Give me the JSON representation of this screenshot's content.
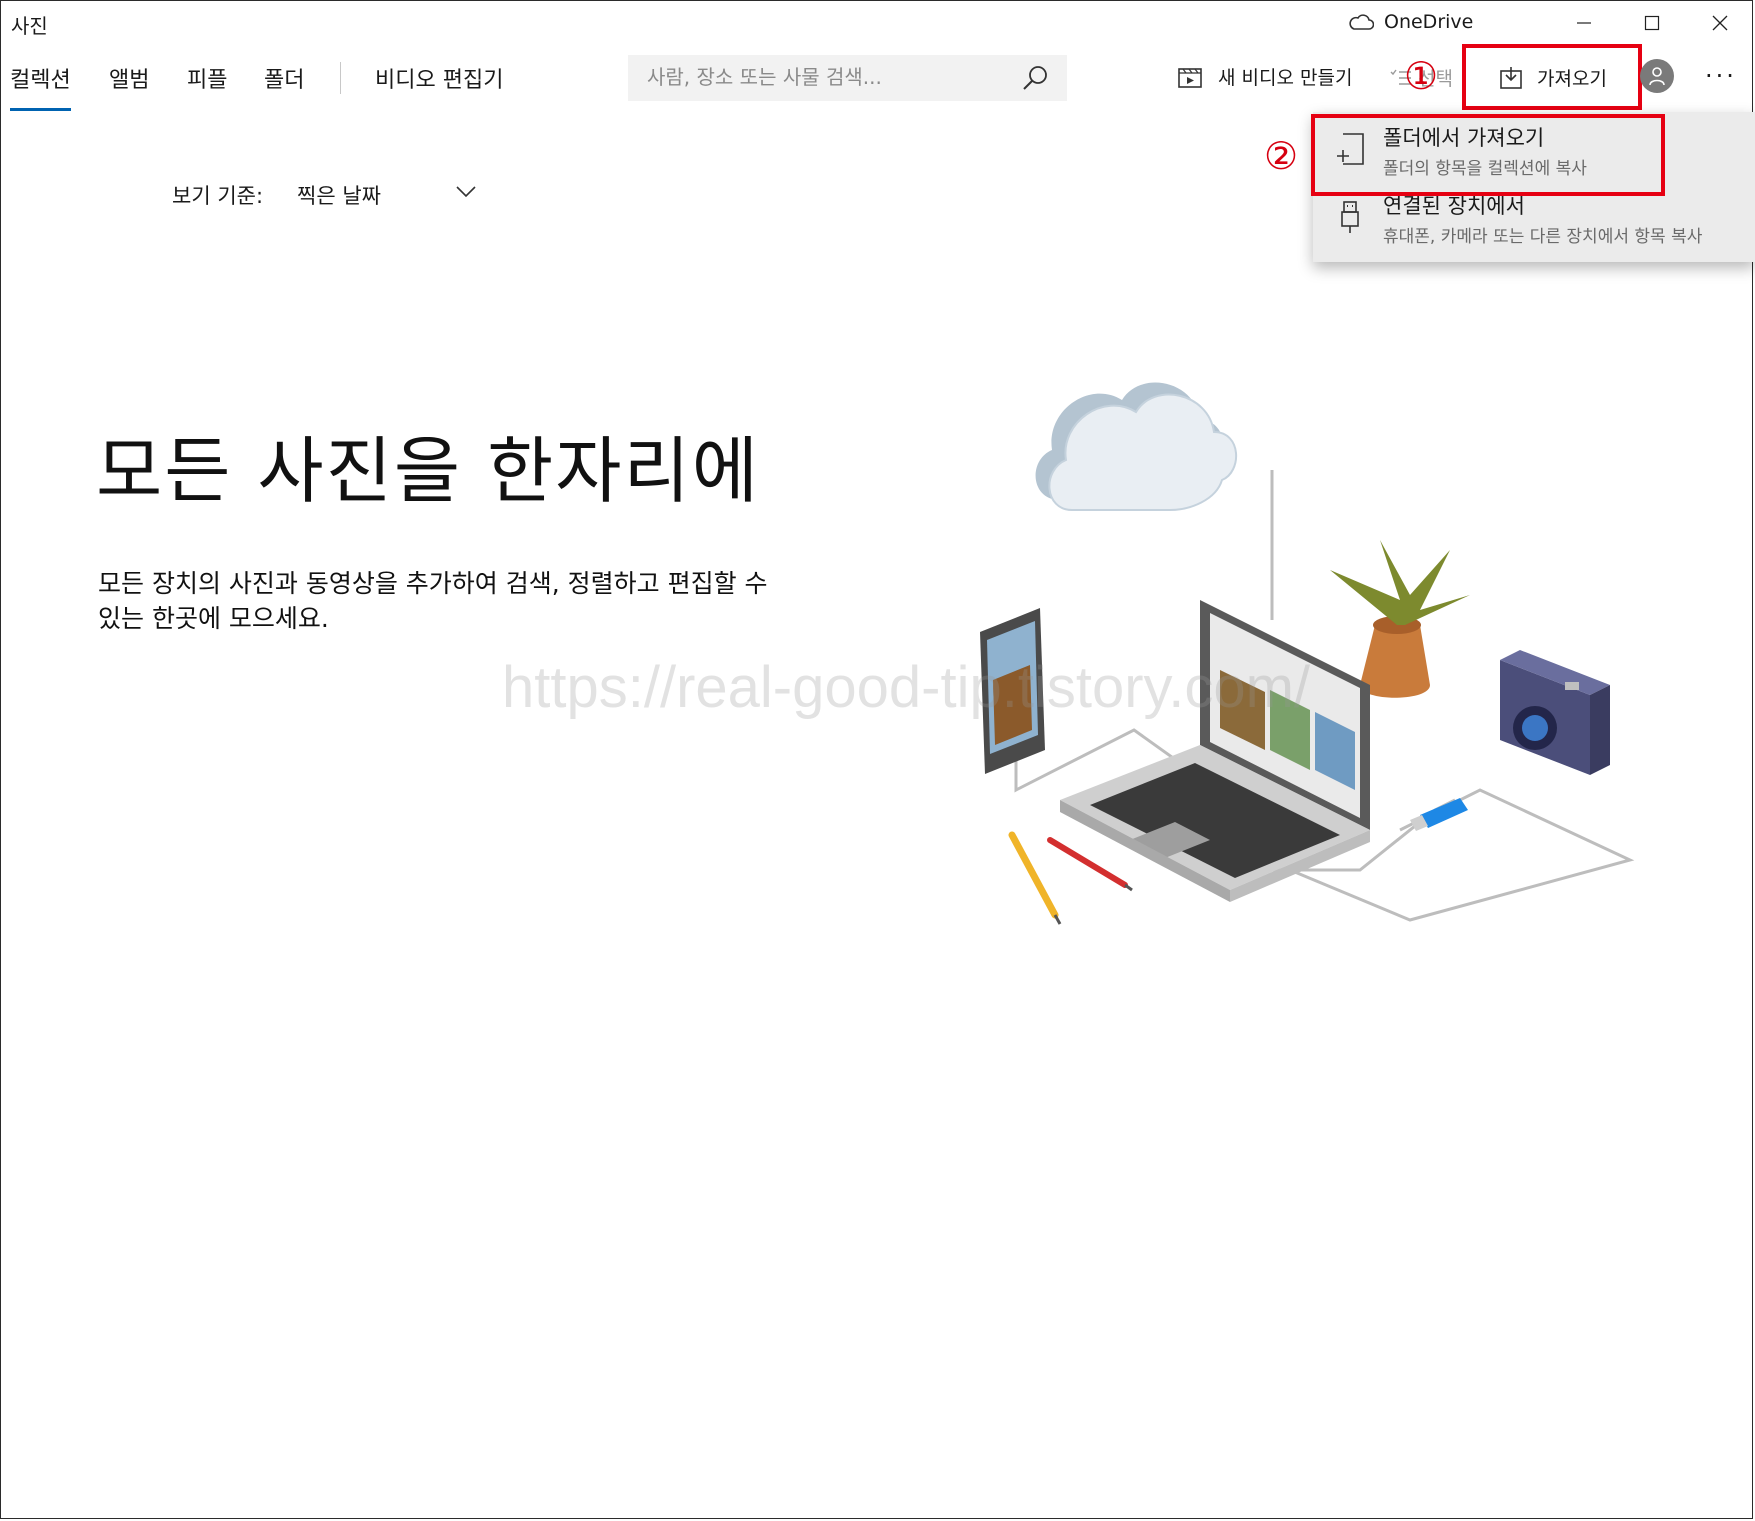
{
  "window": {
    "title": "사진",
    "onedrive_label": "OneDrive"
  },
  "nav": {
    "items": [
      "컬렉션",
      "앨범",
      "피플",
      "폴더"
    ],
    "video_editor": "비디오 편집기"
  },
  "search": {
    "placeholder": "사람, 장소 또는 사물 검색..."
  },
  "toolbar": {
    "new_video_label": "새 비디오 만들기",
    "select_label": "선택",
    "import_label": "가져오기"
  },
  "markers": {
    "step1": "①",
    "step2": "②"
  },
  "import_menu": {
    "items": [
      {
        "title": "폴더에서 가져오기",
        "subtitle": "폴더의 항목을 컬렉션에 복사"
      },
      {
        "title": "연결된 장치에서",
        "subtitle": "휴대폰, 카메라 또는 다른 장치에서 항목 복사"
      }
    ]
  },
  "view_by": {
    "label": "보기 기준:",
    "value": "찍은 날짜"
  },
  "hero": {
    "title": "모든 사진을 한자리에",
    "description": "모든 장치의 사진과 동영상을 추가하여 검색, 정렬하고 편집할 수 있는 한곳에 모으세요."
  },
  "watermark": "https://real-good-tip.tistory.com/",
  "colors": {
    "accent": "#0063b1",
    "highlight": "#e60012",
    "menu_bg": "#ebebeb"
  }
}
